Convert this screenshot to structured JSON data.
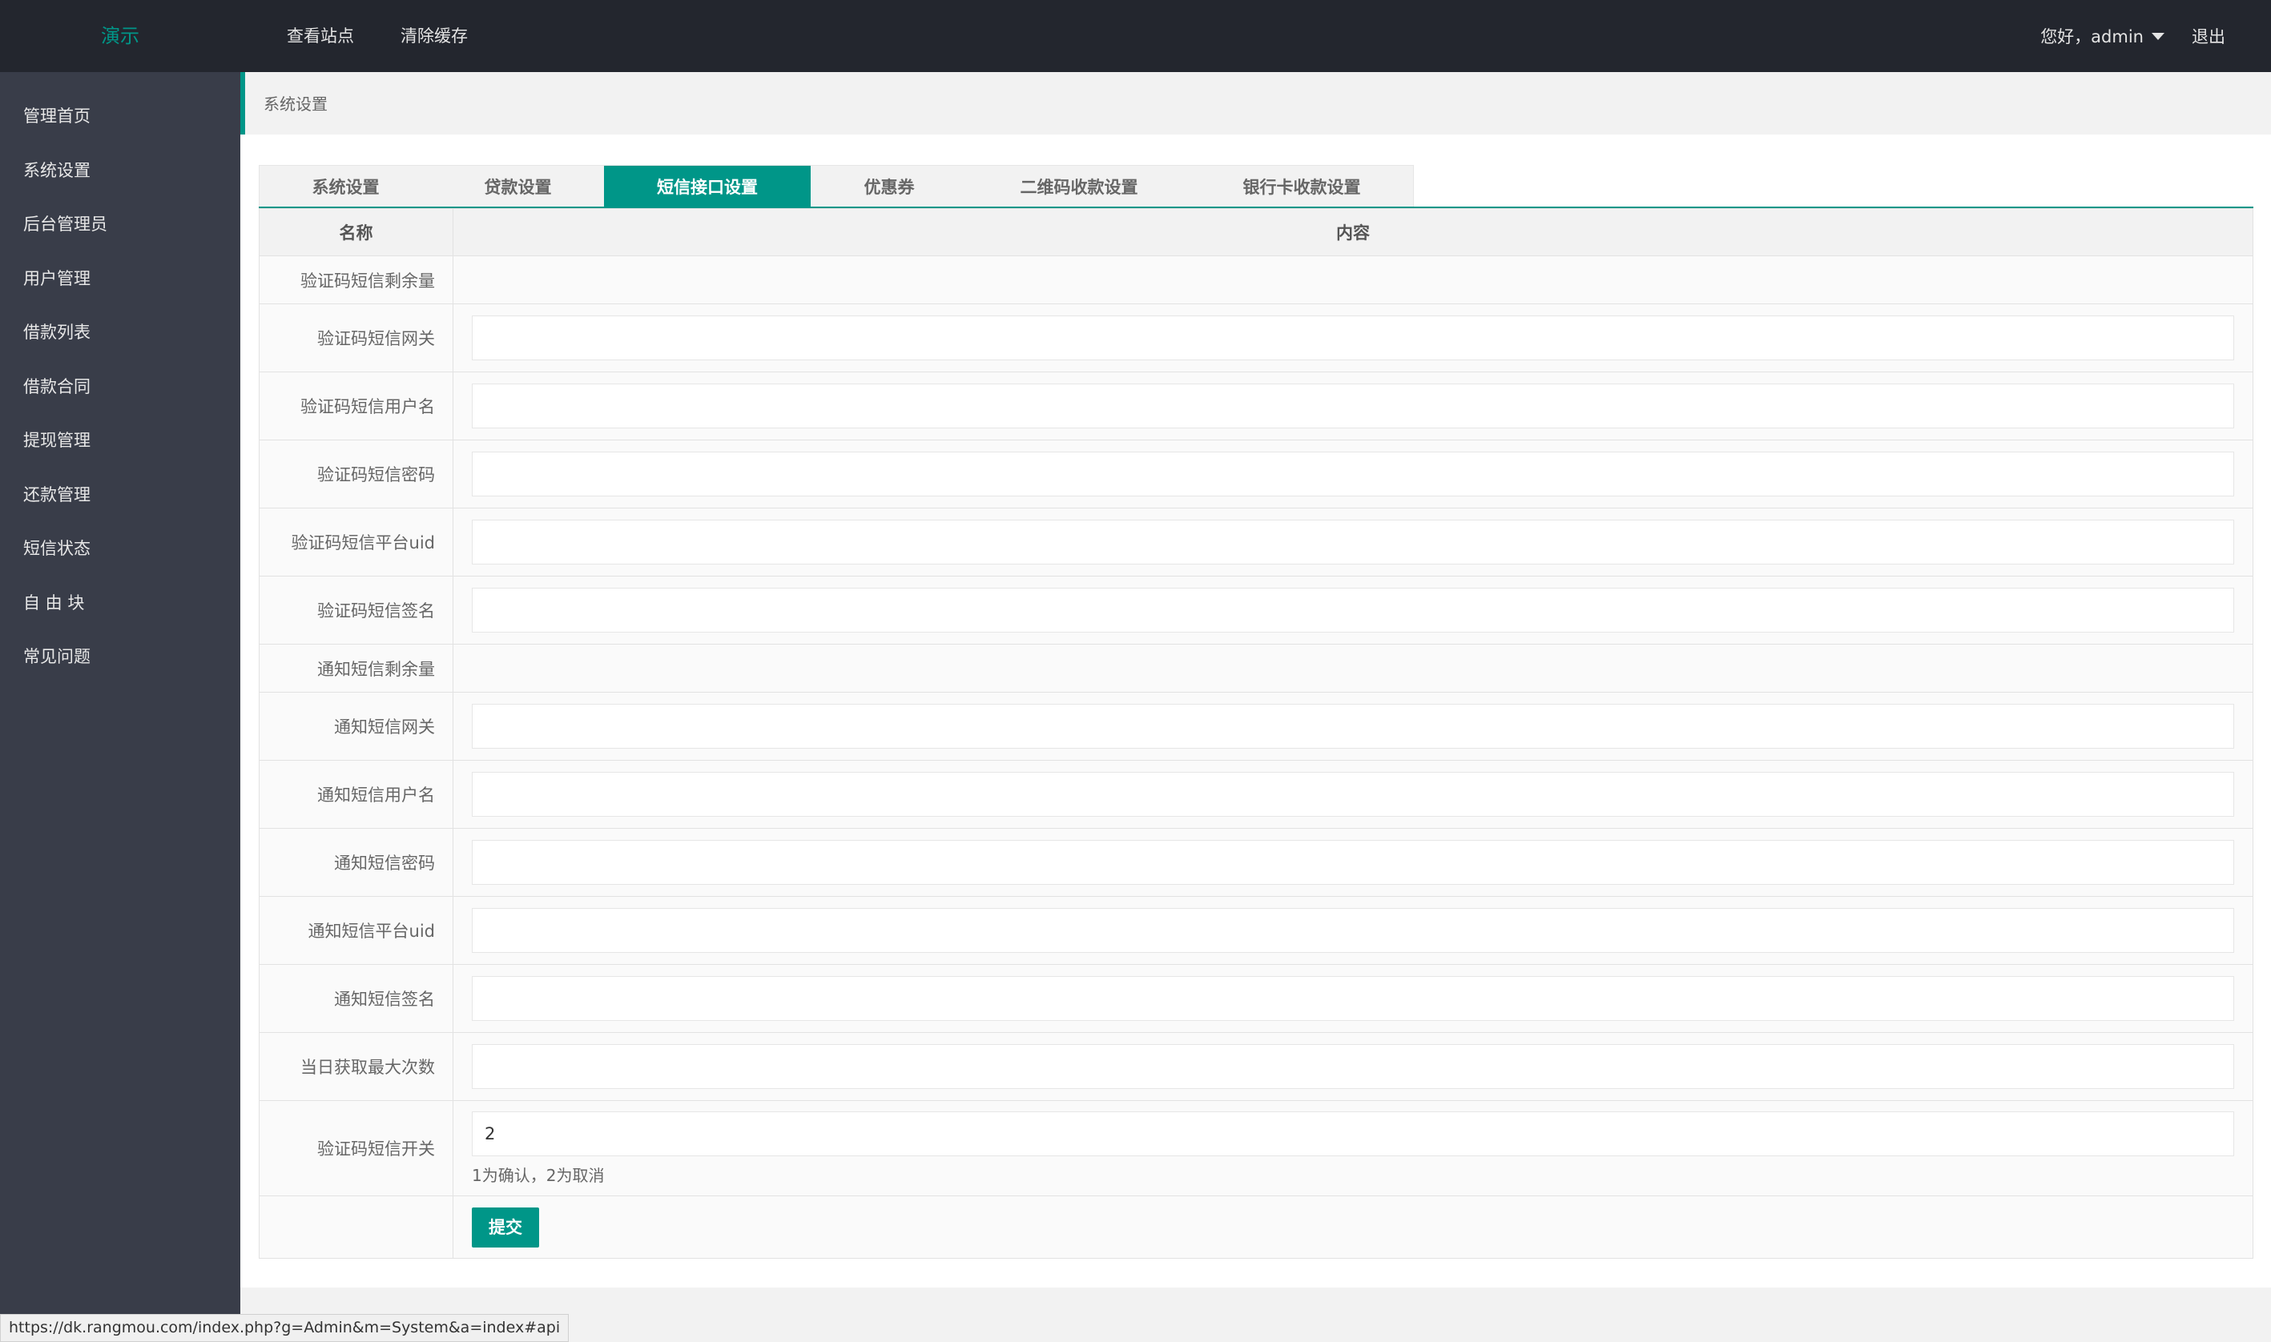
{
  "header": {
    "logo": "演示",
    "nav": [
      "查看站点",
      "清除缓存"
    ],
    "greeting": "您好，admin",
    "logout": "退出"
  },
  "sidebar": {
    "items": [
      {
        "label": "管理首页"
      },
      {
        "label": "系统设置"
      },
      {
        "label": "后台管理员"
      },
      {
        "label": "用户管理"
      },
      {
        "label": "借款列表"
      },
      {
        "label": "借款合同"
      },
      {
        "label": "提现管理"
      },
      {
        "label": "还款管理"
      },
      {
        "label": "短信状态"
      },
      {
        "label": "自 由 块"
      },
      {
        "label": "常见问题"
      }
    ]
  },
  "breadcrumb": "系统设置",
  "tabs": [
    {
      "label": "系统设置"
    },
    {
      "label": "贷款设置"
    },
    {
      "label": "短信接口设置"
    },
    {
      "label": "优惠券"
    },
    {
      "label": "二维码收款设置"
    },
    {
      "label": "银行卡收款设置"
    }
  ],
  "table": {
    "headers": {
      "name": "名称",
      "content": "内容"
    },
    "rows": [
      {
        "label": "验证码短信剩余量",
        "value": ""
      },
      {
        "label": "验证码短信网关",
        "value": ""
      },
      {
        "label": "验证码短信用户名",
        "value": ""
      },
      {
        "label": "验证码短信密码",
        "value": ""
      },
      {
        "label": "验证码短信平台uid",
        "value": ""
      },
      {
        "label": "验证码短信签名",
        "value": ""
      },
      {
        "label": "通知短信剩余量",
        "value": ""
      },
      {
        "label": "通知短信网关",
        "value": ""
      },
      {
        "label": "通知短信用户名",
        "value": ""
      },
      {
        "label": "通知短信密码",
        "value": ""
      },
      {
        "label": "通知短信平台uid",
        "value": ""
      },
      {
        "label": "通知短信签名",
        "value": ""
      },
      {
        "label": "当日获取最大次数",
        "value": ""
      },
      {
        "label": "验证码短信开关",
        "value": "2",
        "hint": "1为确认，2为取消"
      }
    ],
    "submit": "提交"
  },
  "status_url": "https://dk.rangmou.com/index.php?g=Admin&m=System&a=index#api",
  "colors": {
    "accent": "#009688",
    "header_bg": "#23262e",
    "sidebar_bg": "#393d49"
  }
}
